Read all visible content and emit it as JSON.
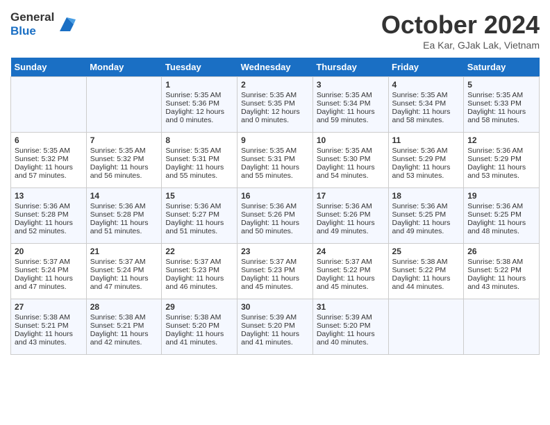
{
  "header": {
    "logo_line1": "General",
    "logo_line2": "Blue",
    "month": "October 2024",
    "location": "Ea Kar, GJak Lak, Vietnam"
  },
  "weekdays": [
    "Sunday",
    "Monday",
    "Tuesday",
    "Wednesday",
    "Thursday",
    "Friday",
    "Saturday"
  ],
  "weeks": [
    [
      {
        "day": "",
        "content": ""
      },
      {
        "day": "",
        "content": ""
      },
      {
        "day": "1",
        "content": "Sunrise: 5:35 AM\nSunset: 5:36 PM\nDaylight: 12 hours\nand 0 minutes."
      },
      {
        "day": "2",
        "content": "Sunrise: 5:35 AM\nSunset: 5:35 PM\nDaylight: 12 hours\nand 0 minutes."
      },
      {
        "day": "3",
        "content": "Sunrise: 5:35 AM\nSunset: 5:34 PM\nDaylight: 11 hours\nand 59 minutes."
      },
      {
        "day": "4",
        "content": "Sunrise: 5:35 AM\nSunset: 5:34 PM\nDaylight: 11 hours\nand 58 minutes."
      },
      {
        "day": "5",
        "content": "Sunrise: 5:35 AM\nSunset: 5:33 PM\nDaylight: 11 hours\nand 58 minutes."
      }
    ],
    [
      {
        "day": "6",
        "content": "Sunrise: 5:35 AM\nSunset: 5:32 PM\nDaylight: 11 hours\nand 57 minutes."
      },
      {
        "day": "7",
        "content": "Sunrise: 5:35 AM\nSunset: 5:32 PM\nDaylight: 11 hours\nand 56 minutes."
      },
      {
        "day": "8",
        "content": "Sunrise: 5:35 AM\nSunset: 5:31 PM\nDaylight: 11 hours\nand 55 minutes."
      },
      {
        "day": "9",
        "content": "Sunrise: 5:35 AM\nSunset: 5:31 PM\nDaylight: 11 hours\nand 55 minutes."
      },
      {
        "day": "10",
        "content": "Sunrise: 5:35 AM\nSunset: 5:30 PM\nDaylight: 11 hours\nand 54 minutes."
      },
      {
        "day": "11",
        "content": "Sunrise: 5:36 AM\nSunset: 5:29 PM\nDaylight: 11 hours\nand 53 minutes."
      },
      {
        "day": "12",
        "content": "Sunrise: 5:36 AM\nSunset: 5:29 PM\nDaylight: 11 hours\nand 53 minutes."
      }
    ],
    [
      {
        "day": "13",
        "content": "Sunrise: 5:36 AM\nSunset: 5:28 PM\nDaylight: 11 hours\nand 52 minutes."
      },
      {
        "day": "14",
        "content": "Sunrise: 5:36 AM\nSunset: 5:28 PM\nDaylight: 11 hours\nand 51 minutes."
      },
      {
        "day": "15",
        "content": "Sunrise: 5:36 AM\nSunset: 5:27 PM\nDaylight: 11 hours\nand 51 minutes."
      },
      {
        "day": "16",
        "content": "Sunrise: 5:36 AM\nSunset: 5:26 PM\nDaylight: 11 hours\nand 50 minutes."
      },
      {
        "day": "17",
        "content": "Sunrise: 5:36 AM\nSunset: 5:26 PM\nDaylight: 11 hours\nand 49 minutes."
      },
      {
        "day": "18",
        "content": "Sunrise: 5:36 AM\nSunset: 5:25 PM\nDaylight: 11 hours\nand 49 minutes."
      },
      {
        "day": "19",
        "content": "Sunrise: 5:36 AM\nSunset: 5:25 PM\nDaylight: 11 hours\nand 48 minutes."
      }
    ],
    [
      {
        "day": "20",
        "content": "Sunrise: 5:37 AM\nSunset: 5:24 PM\nDaylight: 11 hours\nand 47 minutes."
      },
      {
        "day": "21",
        "content": "Sunrise: 5:37 AM\nSunset: 5:24 PM\nDaylight: 11 hours\nand 47 minutes."
      },
      {
        "day": "22",
        "content": "Sunrise: 5:37 AM\nSunset: 5:23 PM\nDaylight: 11 hours\nand 46 minutes."
      },
      {
        "day": "23",
        "content": "Sunrise: 5:37 AM\nSunset: 5:23 PM\nDaylight: 11 hours\nand 45 minutes."
      },
      {
        "day": "24",
        "content": "Sunrise: 5:37 AM\nSunset: 5:22 PM\nDaylight: 11 hours\nand 45 minutes."
      },
      {
        "day": "25",
        "content": "Sunrise: 5:38 AM\nSunset: 5:22 PM\nDaylight: 11 hours\nand 44 minutes."
      },
      {
        "day": "26",
        "content": "Sunrise: 5:38 AM\nSunset: 5:22 PM\nDaylight: 11 hours\nand 43 minutes."
      }
    ],
    [
      {
        "day": "27",
        "content": "Sunrise: 5:38 AM\nSunset: 5:21 PM\nDaylight: 11 hours\nand 43 minutes."
      },
      {
        "day": "28",
        "content": "Sunrise: 5:38 AM\nSunset: 5:21 PM\nDaylight: 11 hours\nand 42 minutes."
      },
      {
        "day": "29",
        "content": "Sunrise: 5:38 AM\nSunset: 5:20 PM\nDaylight: 11 hours\nand 41 minutes."
      },
      {
        "day": "30",
        "content": "Sunrise: 5:39 AM\nSunset: 5:20 PM\nDaylight: 11 hours\nand 41 minutes."
      },
      {
        "day": "31",
        "content": "Sunrise: 5:39 AM\nSunset: 5:20 PM\nDaylight: 11 hours\nand 40 minutes."
      },
      {
        "day": "",
        "content": ""
      },
      {
        "day": "",
        "content": ""
      }
    ]
  ]
}
